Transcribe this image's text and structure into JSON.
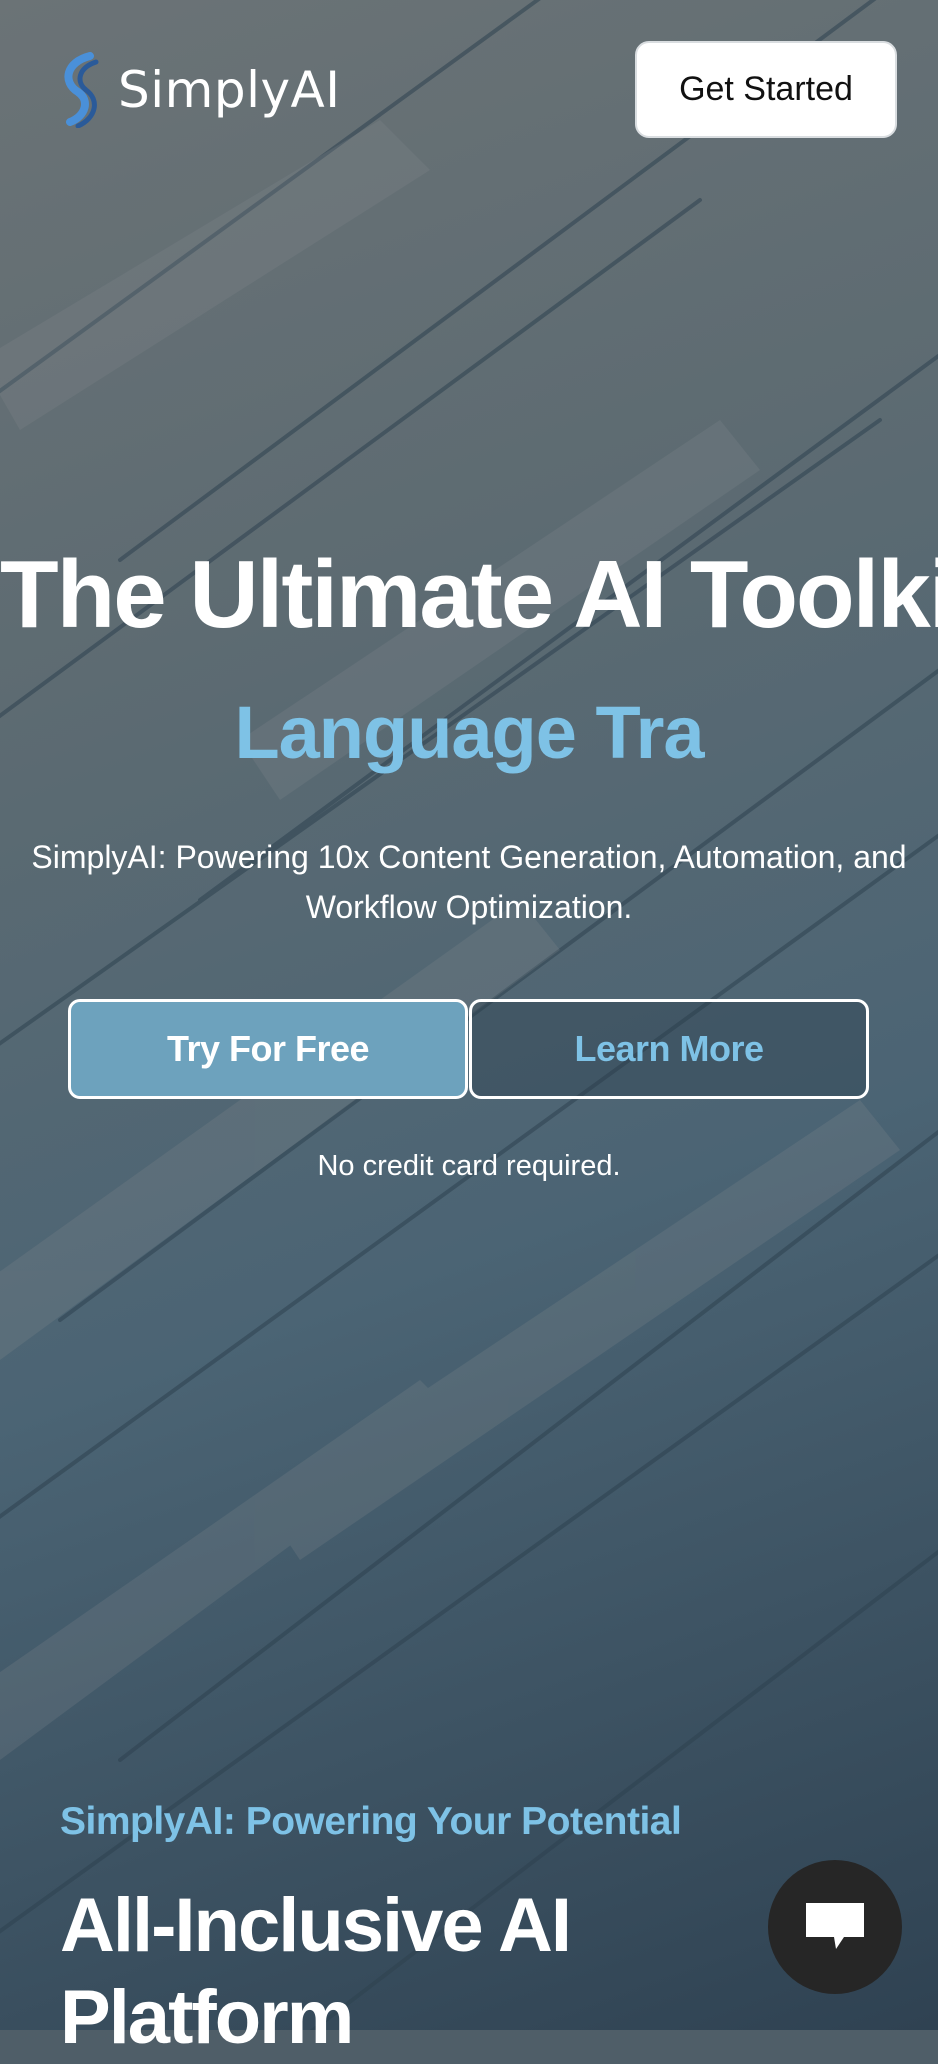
{
  "brand": {
    "name": "SimplyAI",
    "logo_icon": "swirl-logo-icon",
    "accent_color": "#7ec2e6"
  },
  "header": {
    "cta_label": "Get Started"
  },
  "hero": {
    "title": "The Ultimate AI Toolkit",
    "typed_text": "Language Tra",
    "subtitle": "SimplyAI: Powering 10x Content Generation, Automation, and Workflow Optimization.",
    "primary_button": "Try For Free",
    "secondary_button": "Learn More",
    "note": "No credit card required."
  },
  "section": {
    "eyebrow": "SimplyAI: Powering Your Potential",
    "title": "All-Inclusive AI Platform"
  },
  "chat": {
    "icon": "chat-bubble-icon"
  }
}
